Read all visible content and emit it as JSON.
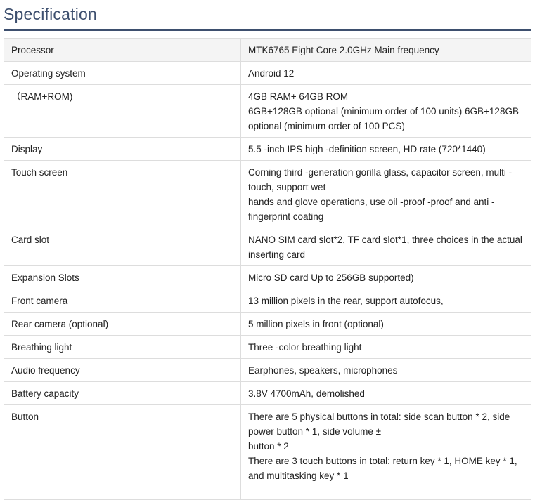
{
  "page": {
    "title": "Specification"
  },
  "rows": [
    {
      "label": "Processor",
      "lines": [
        "MTK6765 Eight Core 2.0GHz Main frequency"
      ]
    },
    {
      "label": "Operating system",
      "lines": [
        "Android 12"
      ]
    },
    {
      "label": "（RAM+ROM)",
      "lines": [
        "4GB RAM+ 64GB ROM",
        "6GB+128GB optional (minimum order of 100 units) 6GB+128GB optional (minimum order of 100 PCS)"
      ]
    },
    {
      "label": "Display",
      "lines": [
        "5.5 -inch IPS high -definition screen, HD rate (720*1440)"
      ]
    },
    {
      "label": "Touch screen",
      "lines": [
        "Corning third -generation gorilla glass, capacitor screen, multi -touch, support wet",
        "hands and glove operations, use oil -proof -proof and anti -fingerprint coating"
      ]
    },
    {
      "label": "Card slot",
      "lines": [
        "NANO SIM card slot*2, TF card slot*1, three choices in the actual inserting card"
      ]
    },
    {
      "label": "Expansion Slots",
      "lines": [
        "Micro SD card Up to 256GB supported)"
      ]
    },
    {
      "label": "Front camera",
      "lines": [
        "13 million pixels in the rear, support autofocus,"
      ]
    },
    {
      "label": "Rear camera (optional)",
      "lines": [
        "5 million pixels in front (optional)"
      ]
    },
    {
      "label": "Breathing light",
      "lines": [
        "Three -color breathing light"
      ]
    },
    {
      "label": "Audio frequency",
      "lines": [
        "Earphones, speakers, microphones"
      ]
    },
    {
      "label": "Battery capacity",
      "lines": [
        "3.8V 4700mAh, demolished"
      ]
    },
    {
      "label": "Button",
      "lines": [
        "There are 5 physical buttons in total: side scan button * 2, side power button * 1, side volume ±",
        "button * 2",
        "There are 3 touch buttons in total: return key * 1, HOME key * 1, and multitasking key * 1"
      ]
    }
  ]
}
